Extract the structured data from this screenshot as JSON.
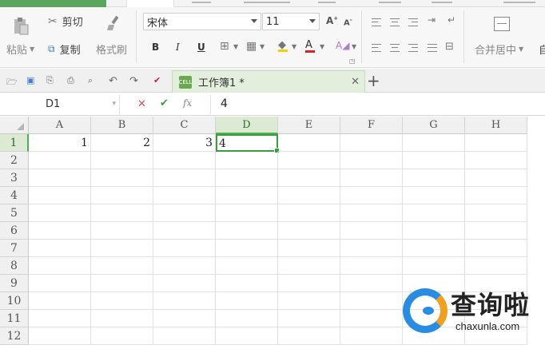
{
  "ribbon": {
    "paste_label": "粘贴",
    "cut_label": "剪切",
    "copy_label": "复制",
    "format_painter_label": "格式刷",
    "font_name": "宋体",
    "font_size": "11",
    "bold": "B",
    "italic": "I",
    "underline": "U",
    "merge_center_label": "合并居中",
    "autowrap_partial": "自"
  },
  "doc_tab": {
    "name": "工作簿1 *",
    "icon_text": "CELL"
  },
  "formula_bar": {
    "name_box": "D1",
    "fx_label": "fx",
    "value": "4"
  },
  "grid": {
    "columns": [
      "A",
      "B",
      "C",
      "D",
      "E",
      "F",
      "G",
      "H"
    ],
    "rows": [
      "1",
      "2",
      "3",
      "4",
      "5",
      "6",
      "7",
      "8",
      "9",
      "10",
      "11",
      "12"
    ],
    "selected_cell": "D1",
    "cells": {
      "A1": "1",
      "B1": "2",
      "C1": "3",
      "D1": "4"
    }
  },
  "watermark": {
    "title": "查询啦",
    "url": "chaxunla.com"
  }
}
